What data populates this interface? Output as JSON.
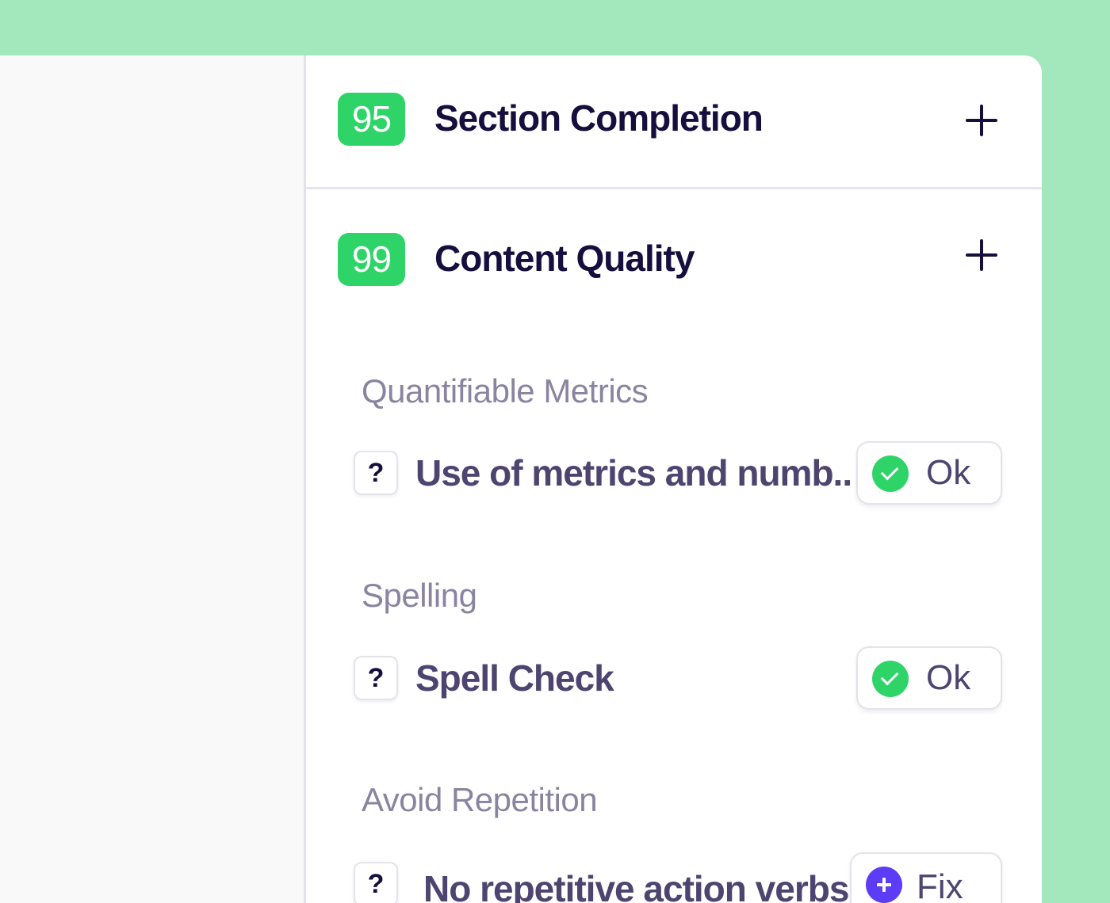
{
  "sections": [
    {
      "score": "95",
      "title": "Section Completion"
    },
    {
      "score": "99",
      "title": "Content Quality"
    }
  ],
  "content_quality": {
    "groups": [
      {
        "heading": "Quantifiable Metrics",
        "check": {
          "help": "?",
          "label": "Use of metrics and numb..",
          "status": "Ok"
        }
      },
      {
        "heading": "Spelling",
        "check": {
          "help": "?",
          "label": "Spell Check",
          "status": "Ok"
        }
      },
      {
        "heading": "Avoid Repetition",
        "check": {
          "help": "?",
          "label_prefix": "No repetitive ",
          "label_link": "action verbs",
          "status": "Fix"
        }
      }
    ]
  },
  "colors": {
    "background": "#a3e8bd",
    "score_badge": "#2ed468",
    "ok_icon": "#2ed468",
    "fix_icon": "#5d3cf5",
    "title_text": "#160f3e",
    "subhead_text": "#8a84a0",
    "label_text": "#4d4570"
  },
  "icons": {
    "expand": "plus-icon",
    "help": "question-mark-icon",
    "ok": "check-circle-icon",
    "fix": "plus-circle-icon"
  }
}
